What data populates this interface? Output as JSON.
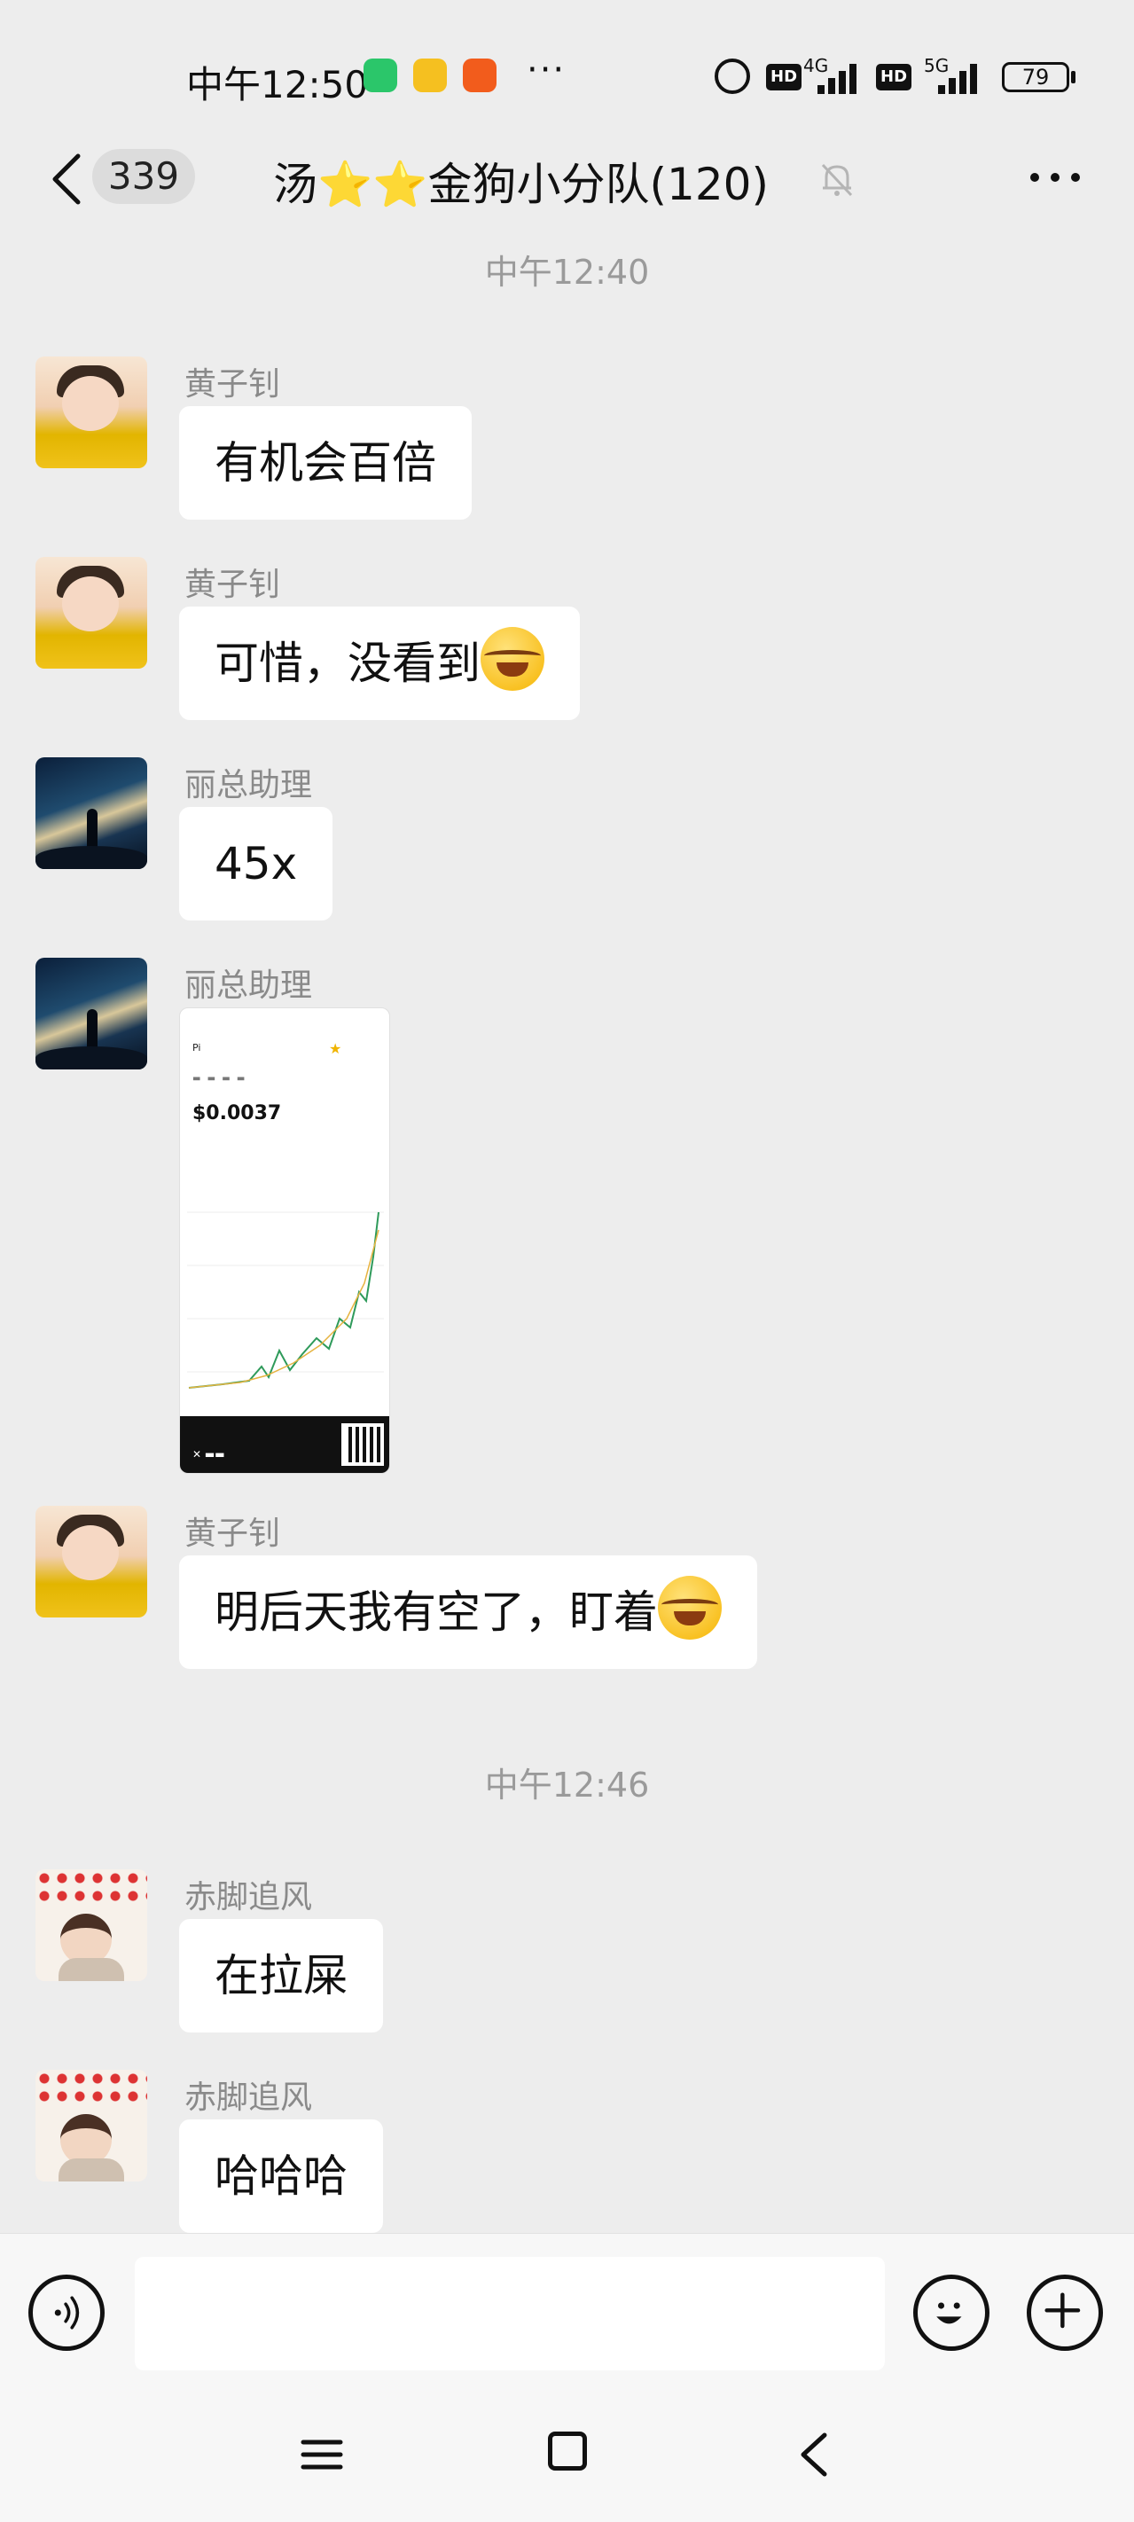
{
  "status_bar": {
    "time": "中午12:50",
    "more": "···",
    "hd1": "HD",
    "net1": "4G",
    "hd2": "HD",
    "net2": "5G",
    "battery": "79"
  },
  "header": {
    "unread_count": "339",
    "title": "汤⭐⭐金狗小分队(120)",
    "icons": [
      "back-icon",
      "mute-bell-icon",
      "more-icon"
    ]
  },
  "chat": {
    "time_1": "中午12:40",
    "time_2": "中午12:46",
    "messages": [
      {
        "sender": "黄子钊",
        "text": "有机会百倍"
      },
      {
        "sender": "黄子钊",
        "text": "可惜，没看到"
      },
      {
        "sender": "丽总助理",
        "text": "45x"
      },
      {
        "sender": "丽总助理",
        "image": {
          "token": "Pi",
          "price": "$0.0037"
        }
      },
      {
        "sender": "黄子钊",
        "text": "明后天我有空了，盯着"
      },
      {
        "sender": "赤脚追风",
        "text": "在拉屎"
      },
      {
        "sender": "赤脚追风",
        "text": "哈哈哈"
      }
    ]
  },
  "input_bar": {
    "placeholder": "",
    "icons": [
      "voice-icon",
      "emoji-icon",
      "plus-icon"
    ]
  },
  "nav_bar": {
    "icons": [
      "menu-icon",
      "home-icon",
      "back-icon"
    ]
  }
}
